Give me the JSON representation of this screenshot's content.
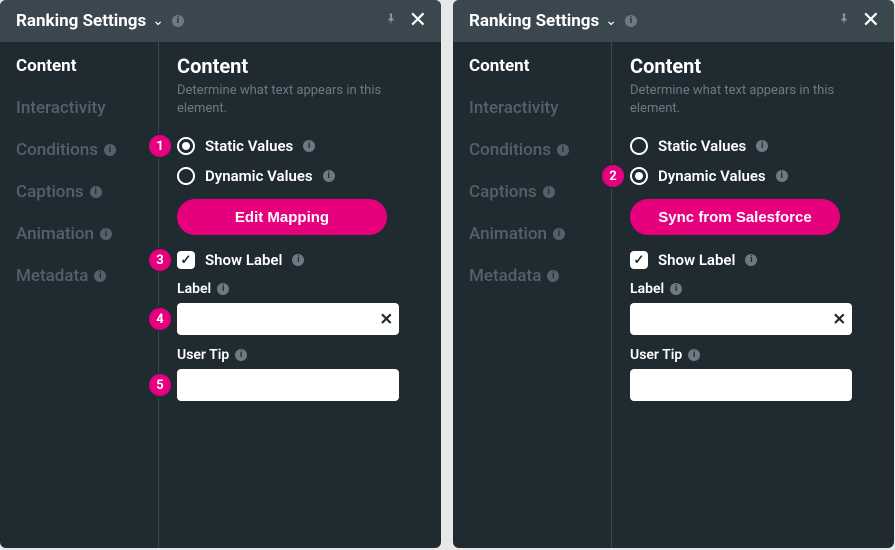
{
  "panels": [
    {
      "title": "Ranking Settings",
      "sidebar": {
        "items": [
          {
            "label": "Content",
            "active": true,
            "info": false
          },
          {
            "label": "Interactivity",
            "active": false,
            "info": false
          },
          {
            "label": "Conditions",
            "active": false,
            "info": true
          },
          {
            "label": "Captions",
            "active": false,
            "info": true
          },
          {
            "label": "Animation",
            "active": false,
            "info": true
          },
          {
            "label": "Metadata",
            "active": false,
            "info": true
          }
        ]
      },
      "content": {
        "heading": "Content",
        "description": "Determine what text appears in this element.",
        "radio_static": "Static Values",
        "radio_dynamic": "Dynamic Values",
        "selected": "static",
        "button": "Edit Mapping",
        "show_label": "Show Label",
        "show_label_checked": true,
        "label_title": "Label",
        "label_value": "",
        "usertip_title": "User Tip",
        "usertip_value": ""
      },
      "callouts": {
        "1": true,
        "3": true,
        "4": true,
        "5": true
      }
    },
    {
      "title": "Ranking Settings",
      "sidebar": {
        "items": [
          {
            "label": "Content",
            "active": true,
            "info": false
          },
          {
            "label": "Interactivity",
            "active": false,
            "info": false
          },
          {
            "label": "Conditions",
            "active": false,
            "info": true
          },
          {
            "label": "Captions",
            "active": false,
            "info": true
          },
          {
            "label": "Animation",
            "active": false,
            "info": true
          },
          {
            "label": "Metadata",
            "active": false,
            "info": true
          }
        ]
      },
      "content": {
        "heading": "Content",
        "description": "Determine what text appears in this element.",
        "radio_static": "Static Values",
        "radio_dynamic": "Dynamic Values",
        "selected": "dynamic",
        "button": "Sync from Salesforce",
        "show_label": "Show Label",
        "show_label_checked": true,
        "label_title": "Label",
        "label_value": "",
        "usertip_title": "User Tip",
        "usertip_value": ""
      },
      "callouts": {
        "2": true
      }
    }
  ]
}
